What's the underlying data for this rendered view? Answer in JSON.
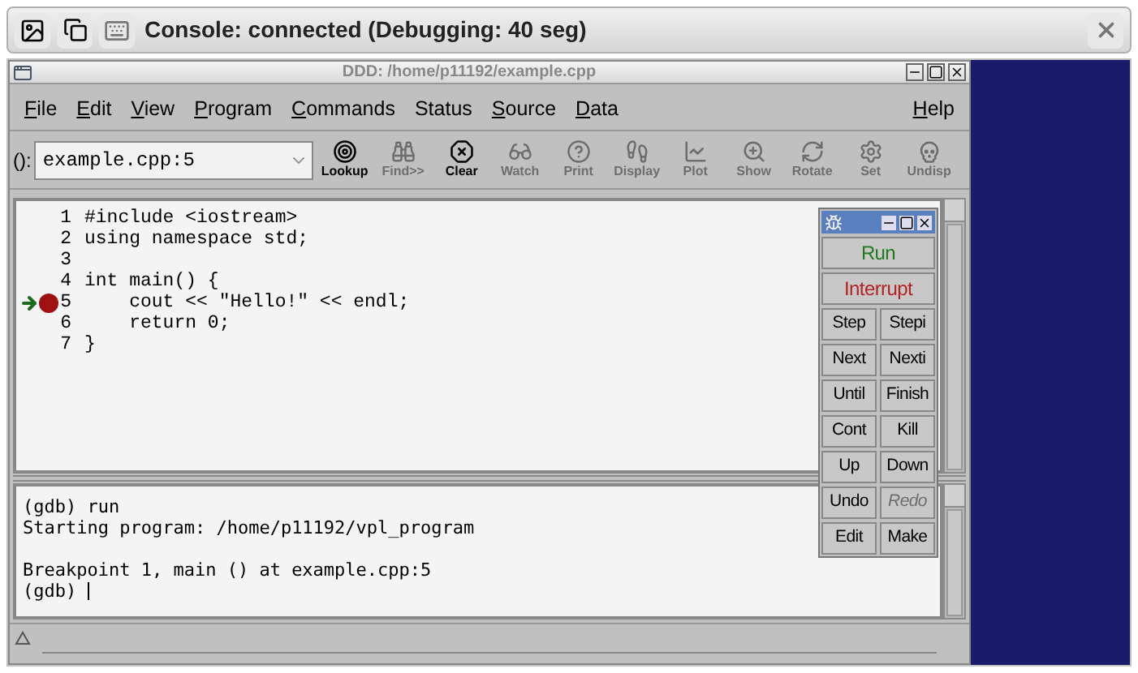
{
  "header": {
    "title": "Console: connected (Debugging: 40 seg)"
  },
  "window": {
    "title": "DDD: /home/p11192/example.cpp"
  },
  "menu": [
    {
      "label": "File",
      "underlined": true
    },
    {
      "label": "Edit",
      "underlined": true
    },
    {
      "label": "View",
      "underlined": true
    },
    {
      "label": "Program",
      "underlined": true
    },
    {
      "label": "Commands",
      "underlined": true
    },
    {
      "label": "Status",
      "underlined": false
    },
    {
      "label": "Source",
      "underlined": true
    },
    {
      "label": "Data",
      "underlined": true
    },
    {
      "label": "Help",
      "underlined": true
    }
  ],
  "argument": {
    "label": "():",
    "value": "example.cpp:5"
  },
  "tools": [
    {
      "label": "Lookup",
      "disabled": false
    },
    {
      "label": "Find>>",
      "disabled": true
    },
    {
      "label": "Clear",
      "disabled": false
    },
    {
      "label": "Watch",
      "disabled": true
    },
    {
      "label": "Print",
      "disabled": true
    },
    {
      "label": "Display",
      "disabled": true
    },
    {
      "label": "Plot",
      "disabled": true
    },
    {
      "label": "Show",
      "disabled": true
    },
    {
      "label": "Rotate",
      "disabled": true
    },
    {
      "label": "Set",
      "disabled": true
    },
    {
      "label": "Undisp",
      "disabled": true
    }
  ],
  "source": [
    {
      "num": "1",
      "text": "#include <iostream>",
      "breakpoint": false,
      "current": false
    },
    {
      "num": "2",
      "text": "using namespace std;",
      "breakpoint": false,
      "current": false
    },
    {
      "num": "3",
      "breakpoint": false,
      "current": false
    },
    {
      "num": "4",
      "text": "int main() {",
      "breakpoint": false,
      "current": false
    },
    {
      "num": "5",
      "text": "    cout << \"Hello!\" << endl;",
      "breakpoint": true,
      "current": true
    },
    {
      "num": "6",
      "text": "    return 0;",
      "breakpoint": false,
      "current": false
    },
    {
      "num": "7",
      "text": "}",
      "breakpoint": false,
      "current": false
    }
  ],
  "console": [
    [
      "(gdb) run",
      "Starting program: /home/p11192/vpl_program"
    ],
    [
      "Breakpoint 1, main () at example.cpp:5",
      "(gdb)"
    ]
  ],
  "commands": [
    [
      {
        "label": "Run",
        "kind": "go",
        "disabled": false
      }
    ],
    [
      {
        "label": "Interrupt",
        "kind": "stop",
        "disabled": false
      }
    ],
    [
      {
        "label": "Step",
        "kind": "plain",
        "disabled": false
      },
      {
        "label": "Stepi",
        "kind": "plain",
        "disabled": false
      }
    ],
    [
      {
        "label": "Next",
        "kind": "plain",
        "disabled": false
      },
      {
        "label": "Nexti",
        "kind": "plain",
        "disabled": false
      }
    ],
    [
      {
        "label": "Until",
        "kind": "plain",
        "disabled": false
      },
      {
        "label": "Finish",
        "kind": "plain",
        "disabled": false
      }
    ],
    [
      {
        "label": "Cont",
        "kind": "plain",
        "disabled": false
      },
      {
        "label": "Kill",
        "kind": "plain",
        "disabled": false
      }
    ],
    [
      {
        "label": "Up",
        "kind": "plain",
        "disabled": false
      },
      {
        "label": "Down",
        "kind": "plain",
        "disabled": false
      }
    ],
    [
      {
        "label": "Undo",
        "kind": "plain",
        "disabled": false
      },
      {
        "label": "Redo",
        "kind": "plain",
        "disabled": true
      }
    ],
    [
      {
        "label": "Edit",
        "kind": "plain",
        "disabled": false
      },
      {
        "label": "Make",
        "kind": "plain",
        "disabled": false
      }
    ]
  ]
}
